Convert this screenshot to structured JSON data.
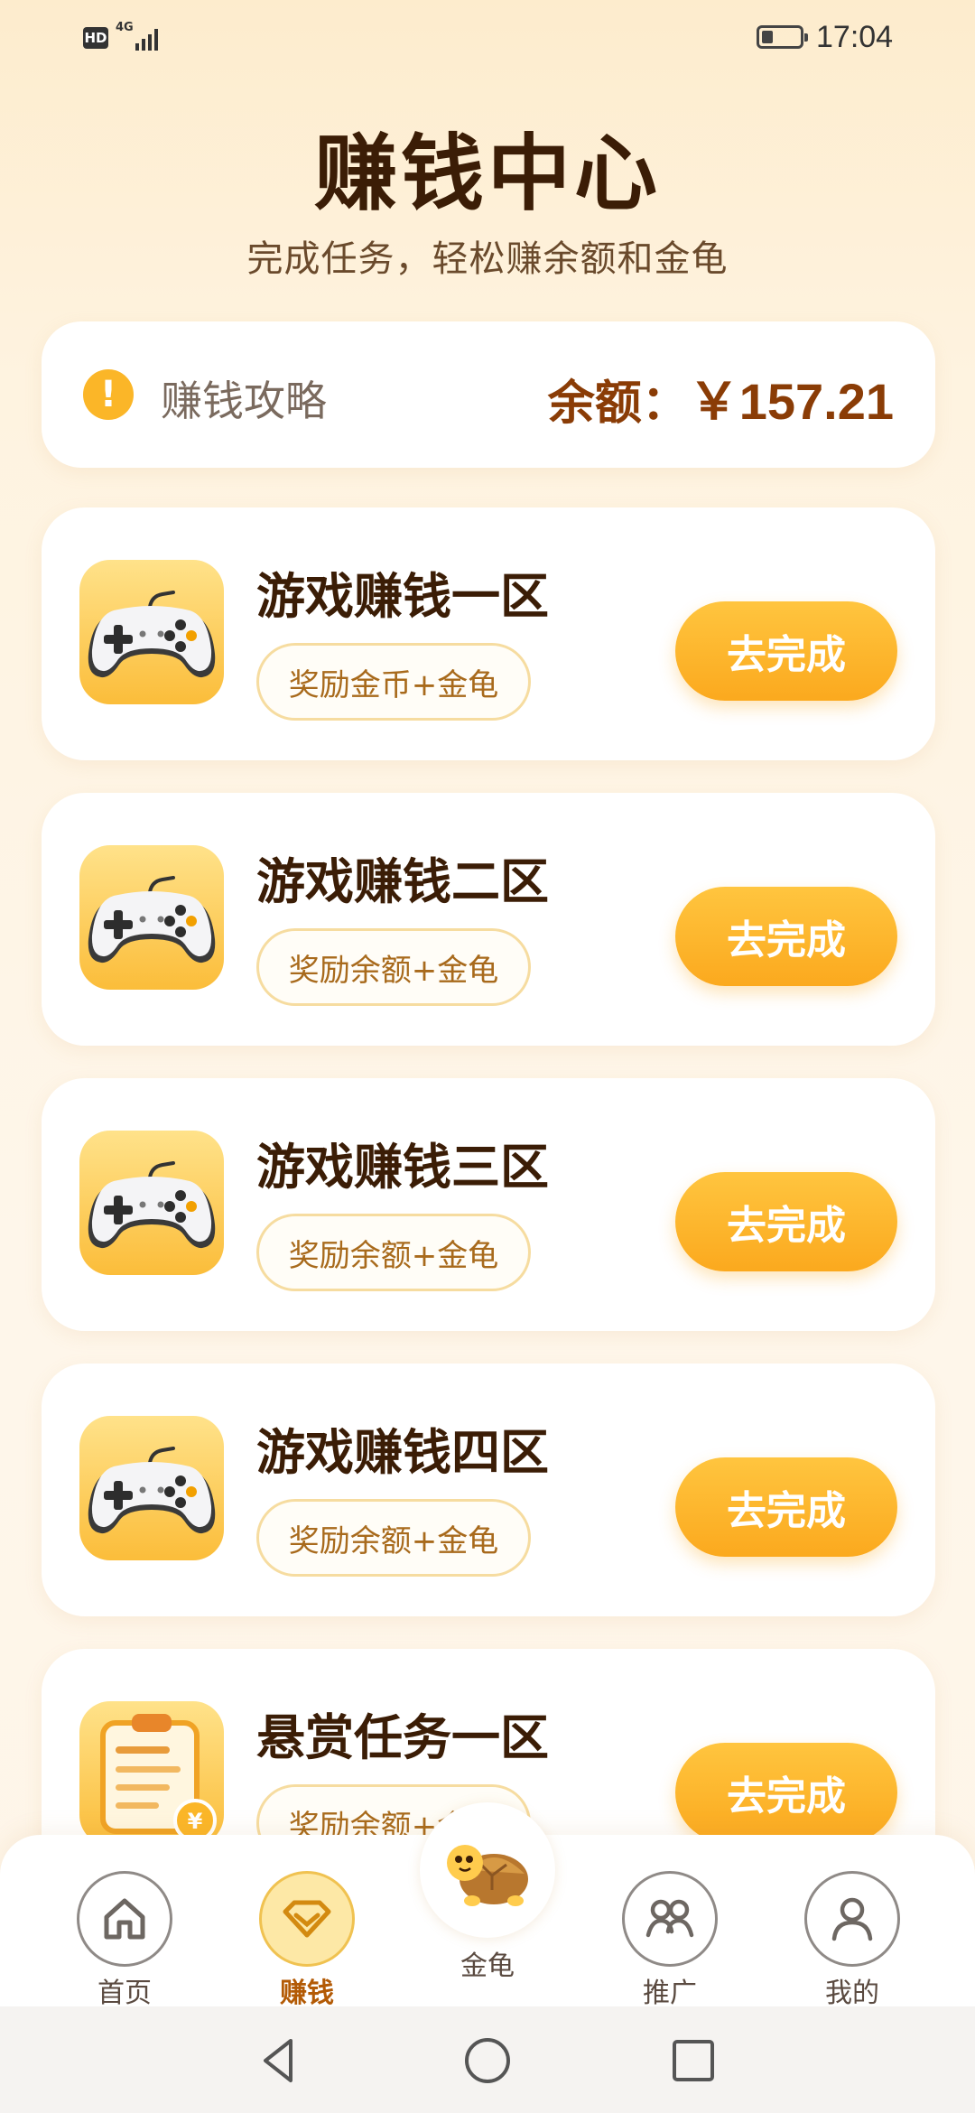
{
  "status_bar": {
    "hd": "HD",
    "network": "4G",
    "time": "17:04",
    "battery_level": 0.3
  },
  "header": {
    "title": "赚钱中心",
    "subtitle": "完成任务，轻松赚余额和金龟"
  },
  "balance_card": {
    "tip_icon": "!",
    "tip_label": "赚钱攻略",
    "balance_label": "余额：",
    "balance_value": "￥157.21"
  },
  "tasks": [
    {
      "name": "游戏赚钱一区",
      "reward": "奖励金币+金龟",
      "button": "去完成",
      "icon": "gamepad-icon"
    },
    {
      "name": "游戏赚钱二区",
      "reward": "奖励余额+金龟",
      "button": "去完成",
      "icon": "gamepad-icon"
    },
    {
      "name": "游戏赚钱三区",
      "reward": "奖励余额+金龟",
      "button": "去完成",
      "icon": "gamepad-icon"
    },
    {
      "name": "游戏赚钱四区",
      "reward": "奖励余额+金龟",
      "button": "去完成",
      "icon": "gamepad-icon"
    },
    {
      "name": "悬赏任务一区",
      "reward": "奖励余额+金龟",
      "button": "去完成",
      "icon": "clipboard-coin-icon"
    }
  ],
  "bottom_nav": {
    "items": [
      {
        "label": "首页",
        "icon": "home-icon"
      },
      {
        "label": "赚钱",
        "icon": "diamond-icon",
        "active": true
      },
      {
        "label": "金龟",
        "icon": "turtle-icon"
      },
      {
        "label": "推广",
        "icon": "people-icon"
      },
      {
        "label": "我的",
        "icon": "user-icon"
      }
    ]
  },
  "colors": {
    "accent": "#fbb628",
    "title": "#3b1d06",
    "balance": "#8a3c06",
    "nav_active": "#b35a05"
  }
}
